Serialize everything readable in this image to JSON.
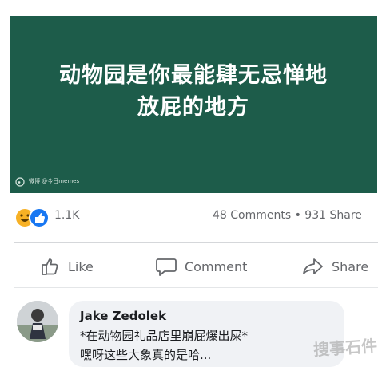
{
  "post": {
    "caption_line1": "动物园是你最能肆无忌惮地",
    "caption_line2": "放屁的地方",
    "watermark": "微博 @今日memes"
  },
  "stats": {
    "reaction_count": "1.1K",
    "comments_shares": "48 Comments • 931 Share"
  },
  "actions": {
    "like": "Like",
    "comment": "Comment",
    "share": "Share"
  },
  "comment": {
    "author": "Jake Zedolek",
    "line1": "*在动物园礼品店里崩屁爆出屎*",
    "line2": "嘿呀这些大象真的是哈..."
  },
  "corner_watermark": "搜事石件",
  "colors": {
    "image_bg": "#1d5c4a",
    "like_blue": "#1877f2",
    "haha_yellow": "#f7b125",
    "muted_text": "#65676b",
    "bubble_bg": "#f0f2f5"
  },
  "icons": {
    "like": "thumbs-up-icon",
    "comment": "speech-bubble-icon",
    "share": "share-arrow-icon",
    "haha": "haha-reaction-icon",
    "like_reaction": "like-reaction-icon"
  }
}
